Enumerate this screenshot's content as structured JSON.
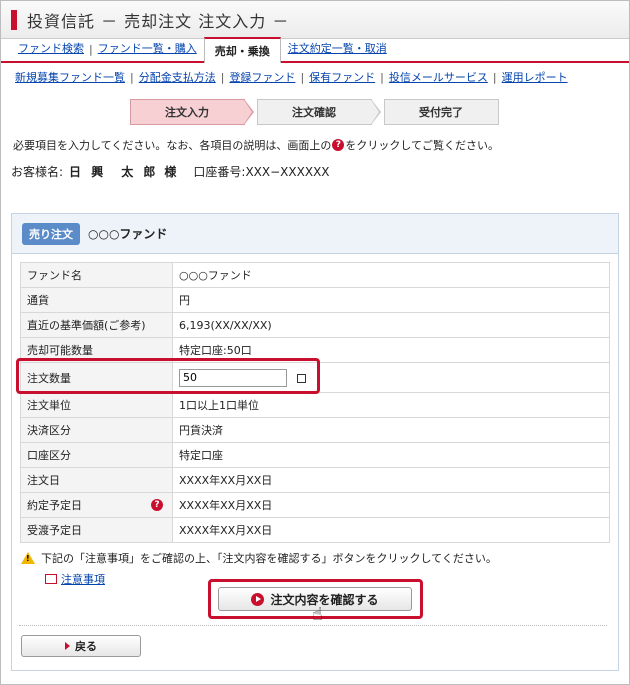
{
  "header": {
    "title": "投資信託 － 売却注文 注文入力 －"
  },
  "nav_primary": [
    {
      "label": "ファンド検索",
      "active": false
    },
    {
      "label": "ファンド一覧・購入",
      "active": false
    },
    {
      "label": "売却・乗換",
      "active": true
    },
    {
      "label": "注文約定一覧・取消",
      "active": false
    }
  ],
  "nav_secondary": [
    {
      "label": "新規募集ファンド一覧"
    },
    {
      "label": "分配金支払方法"
    },
    {
      "label": "登録ファンド"
    },
    {
      "label": "保有ファンド"
    },
    {
      "label": "投信メールサービス"
    },
    {
      "label": "運用レポート"
    }
  ],
  "steps": [
    {
      "label": "注文入力",
      "current": true
    },
    {
      "label": "注文確認",
      "current": false
    },
    {
      "label": "受付完了",
      "current": false
    }
  ],
  "instruction": {
    "before": "必要項目を入力してください。なお、各項目の説明は、画面上の",
    "icon_char": "?",
    "after": "をクリックしてご覧ください。"
  },
  "customer": {
    "label": "お客様名:",
    "name": "日 興　太 郎",
    "honorific": "様",
    "account": "口座番号:XXX−XXXXXX"
  },
  "order": {
    "badge": "売り注文",
    "fund_name": "○○○ファンド"
  },
  "rows": [
    {
      "label": "ファンド名",
      "value": "○○○ファンド"
    },
    {
      "label": "通貨",
      "value": "円"
    },
    {
      "label": "直近の基準価額(ご参考)",
      "value": "6,193(XX/XX/XX)"
    },
    {
      "label": "売却可能数量",
      "value": "特定口座:50口"
    },
    {
      "label": "注文数量",
      "value": "50"
    },
    {
      "label": "注文単位",
      "value": "1口以上1口単位"
    },
    {
      "label": "決済区分",
      "value": "円貨決済"
    },
    {
      "label": "口座区分",
      "value": "特定口座"
    },
    {
      "label": "注文日",
      "value": "XXXX年XX月XX日"
    },
    {
      "label": "約定予定日",
      "value": "XXXX年XX月XX日"
    },
    {
      "label": "受渡予定日",
      "value": "XXXX年XX月XX日"
    }
  ],
  "notice": "下記の「注意事項」をご確認の上、「注文内容を確認する」ボタンをクリックしてください。",
  "caution_link": "注意事項",
  "confirm_button": "注文内容を確認する",
  "back_button": "戻る",
  "colors": {
    "brand_red": "#c8102e",
    "link_blue": "#0645ad",
    "badge_blue": "#5b8bc9"
  }
}
